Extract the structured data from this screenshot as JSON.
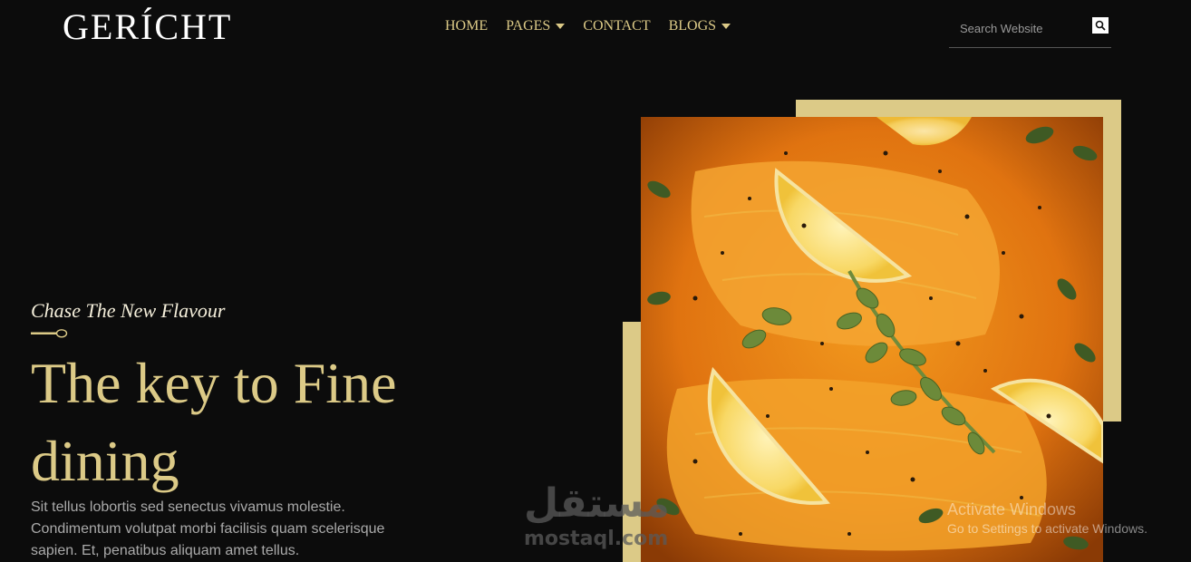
{
  "header": {
    "logo": "GERÍCHT",
    "nav": [
      {
        "label": "HOME",
        "dropdown": false
      },
      {
        "label": "PAGES",
        "dropdown": true
      },
      {
        "label": "CONTACT",
        "dropdown": false
      },
      {
        "label": "BLOGS",
        "dropdown": true
      }
    ],
    "search": {
      "placeholder": "Search Website",
      "icon": "search-icon"
    }
  },
  "hero": {
    "subtitle": "Chase The New Flavour",
    "headline": "The key to Fine dining",
    "description": "Sit tellus lobortis sed senectus vivamus molestie. Condimentum volutpat morbi facilisis quam scelerisque sapien. Et, penatibus aliquam amet tellus.",
    "image": "salmon-dish-with-lemon-and-oregano",
    "accent_color": "#dcca87"
  },
  "watermark": {
    "arabic": "مستقل",
    "latin": "mostaql.com"
  },
  "os_overlay": {
    "line1": "Activate Windows",
    "line2": "Go to Settings to activate Windows."
  }
}
